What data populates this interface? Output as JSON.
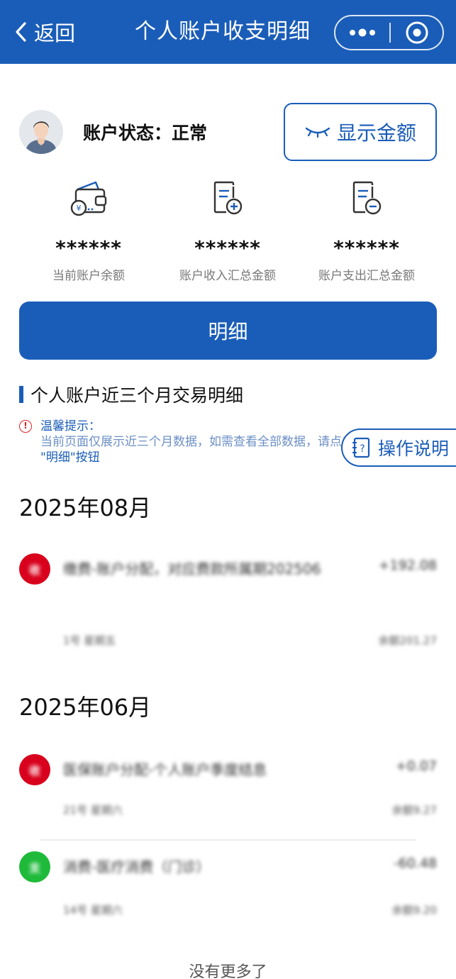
{
  "header": {
    "back_label": "返回",
    "title": "个人账户收支明细"
  },
  "account": {
    "status_label": "账户状态：正常",
    "show_amount_label": "显示金额"
  },
  "stats": [
    {
      "value": "******",
      "label": "当前账户余额",
      "icon": "wallet-icon"
    },
    {
      "value": "******",
      "label": "账户收入汇总金额",
      "icon": "document-plus-icon"
    },
    {
      "value": "******",
      "label": "账户支出汇总金额",
      "icon": "document-minus-icon"
    }
  ],
  "detail_button": "明细",
  "section": {
    "title": "个人账户近三个月交易明细",
    "tip_heading": "温馨提示：",
    "tip_body": "当前页面仅展示近三个月数据，如需查看全部数据，请点击",
    "tip_button_ref": "\"明细\"按钮"
  },
  "guide_label": "操作说明",
  "months": [
    {
      "label": "2025年08月",
      "transactions": [
        {
          "icon_text": "收",
          "color": "#d8001c",
          "title": "缴费-账户分配，对应费款所属期202506",
          "amount": "+192.08",
          "date": "1号 星期五",
          "balance": "余额201.27"
        }
      ]
    },
    {
      "label": "2025年06月",
      "transactions": [
        {
          "icon_text": "收",
          "color": "#d8001c",
          "title": "医保账户分配-个人账户季度结息",
          "amount": "+0.07",
          "date": "21号 星期六",
          "balance": "余额9.27"
        },
        {
          "icon_text": "支",
          "color": "#1fba3a",
          "title": "消费-医疗消费（门诊）",
          "amount": "-60.48",
          "date": "14号 星期六",
          "balance": "余额9.20"
        }
      ]
    }
  ],
  "footer": "没有更多了",
  "colors": {
    "brand": "#1a5db8",
    "income": "#d8001c",
    "expense": "#1fba3a"
  }
}
